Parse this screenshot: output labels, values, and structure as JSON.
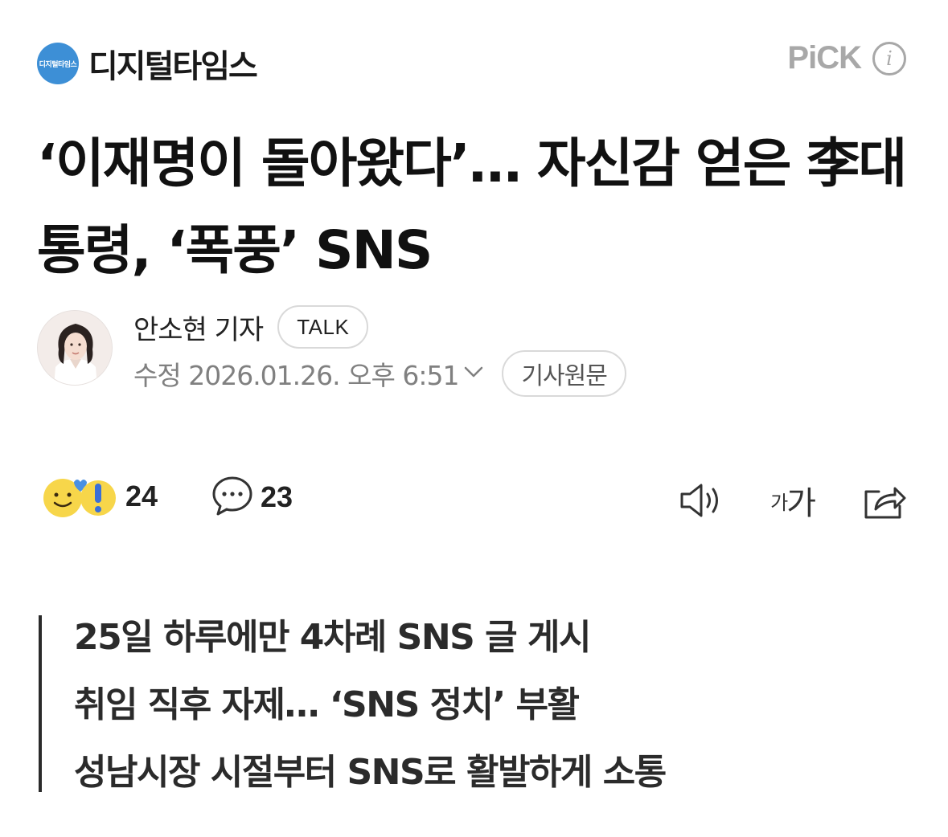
{
  "header": {
    "press_logo_text": "디지털타임스",
    "press_name": "디지털타임스",
    "pick_label": "PiCK",
    "info_icon": "info-icon"
  },
  "article": {
    "headline": "‘이재명이 돌아왔다’… 자신감 얻은 李대통령, ‘폭풍’ SNS"
  },
  "byline": {
    "reporter": "안소현 기자",
    "talk_label": "TALK",
    "date": "수정 2026.01.26. 오후 6:51",
    "original_label": "기사원문"
  },
  "actions": {
    "reaction_count": "24",
    "comment_count": "23",
    "font_small": "가",
    "font_big": "가",
    "icons": [
      "reaction-emoji-icon",
      "comment-icon",
      "speaker-icon",
      "font-size-icon",
      "share-icon"
    ]
  },
  "summary": {
    "lines": [
      "25일 하루에만 4차례 SNS 글 게시",
      "취임 직후 자제… ‘SNS 정치’ 부활",
      "성남시장 시절부터 SNS로 활발하게 소통"
    ]
  },
  "colors": {
    "brand_blue": "#3d8fd6",
    "muted_gray": "#a8a8a8",
    "text_dark": "#111111"
  }
}
